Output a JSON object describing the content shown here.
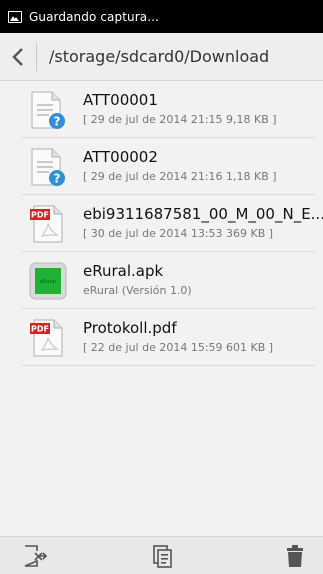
{
  "status_bar": {
    "text": "Guardando captura...",
    "icon": "screenshot-icon"
  },
  "path_bar": {
    "back_icon": "chevron-left-icon",
    "path": "/storage/sdcard0/Download"
  },
  "files": [
    {
      "name": "ATT00001",
      "meta": "[ 29 de jul de 2014 21:15 9,18 KB ]",
      "icon": "unknown-file-icon"
    },
    {
      "name": "ATT00002",
      "meta": "[ 29 de jul de 2014 21:16 1,18 KB ]",
      "icon": "unknown-file-icon"
    },
    {
      "name": "ebi9311687581_00_M_00_N_E...",
      "meta": "[ 30 de jul de 2014 13:53 369 KB ]",
      "icon": "pdf-file-icon"
    },
    {
      "name": "eRural.apk",
      "meta": "eRural (Versión 1.0)",
      "icon": "apk-file-icon",
      "apk_label": "eRural"
    },
    {
      "name": "Protokoll.pdf",
      "meta": "[ 22 de jul de 2014 15:59 601 KB ]",
      "icon": "pdf-file-icon"
    }
  ],
  "pdf_badge": "PDF",
  "unknown_badge": "?",
  "bottom_bar": {
    "icons": [
      "select-all-icon",
      "paste-icon",
      "trash-icon"
    ]
  },
  "colors": {
    "statusbar": "#000000",
    "pdf_red": "#d32626",
    "question_blue": "#2f8fd8",
    "apk_green": "#1fb336"
  }
}
